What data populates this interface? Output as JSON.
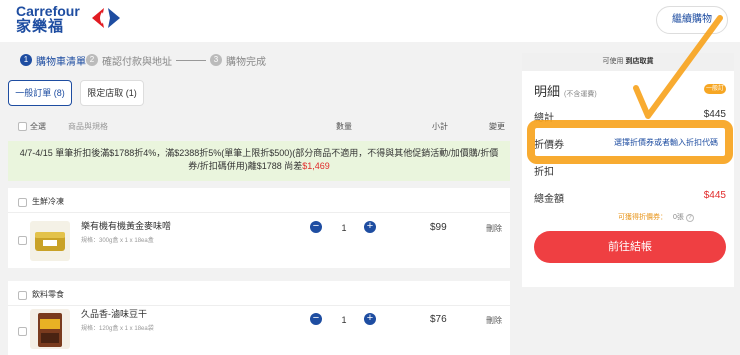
{
  "brand": {
    "name_en": "Carrefour",
    "name_zh": "家樂福"
  },
  "header": {
    "continue_label": "繼續購物"
  },
  "steps": [
    {
      "num": "1",
      "label": "購物車清單"
    },
    {
      "num": "2",
      "label": "確認付款與地址"
    },
    {
      "num": "3",
      "label": "購物完成"
    }
  ],
  "tabs": [
    {
      "label": "一般訂單 (8)",
      "active": true
    },
    {
      "label": "限定店取 (1)",
      "active": false
    }
  ],
  "columns": {
    "select_all": "全選",
    "product": "商品與規格",
    "qty": "數量",
    "subtotal": "小計",
    "change": "變更"
  },
  "promo": {
    "text": "4/7-4/15 單筆折扣後滿$1788折4%，滿$2388折5%(單筆上限折$500)(部分商品不適用，不得與其他促銷活動/加價購/折價券/折扣碼併用)離$1788 尚差",
    "shortfall": "$1,469"
  },
  "sections": [
    {
      "title": "生鮮冷凍",
      "product": {
        "name": "樂有機有機黃金麥味噌",
        "spec": "規格：300g盒 x 1 x 18ea盒",
        "qty": "1",
        "price": "$99",
        "delete": "刪除"
      }
    },
    {
      "title": "飲料零食",
      "product": {
        "name": "久品香-滷味豆干",
        "spec": "規格：120g盒 x 1 x 18ea袋",
        "qty": "1",
        "price": "$76",
        "delete": "刪除"
      }
    }
  ],
  "summary": {
    "available_prefix": "可使用",
    "available_bold": "到店取貨",
    "title": "明細",
    "title_note": "(不含運費)",
    "badge": "一般訂單",
    "total_label": "總計",
    "total_value": "$445",
    "coupon_label": "折價券",
    "coupon_link": "選擇折價券或者輸入折扣代碼",
    "discount_label": "折扣",
    "grand_label": "總金額",
    "grand_value": "$445",
    "points_label": "可獲得折價券：",
    "points_value": "0張",
    "help_mark": "?",
    "checkout_label": "前往結帳"
  },
  "colors": {
    "brand_blue": "#1e4da1",
    "checkout_red": "#ef3f42",
    "price_red": "#e12b2b",
    "highlight_orange": "#f7a21b",
    "promo_green_bg": "#eaf5dd"
  },
  "icons": {
    "qty_minus": "−",
    "qty_plus": "+"
  }
}
